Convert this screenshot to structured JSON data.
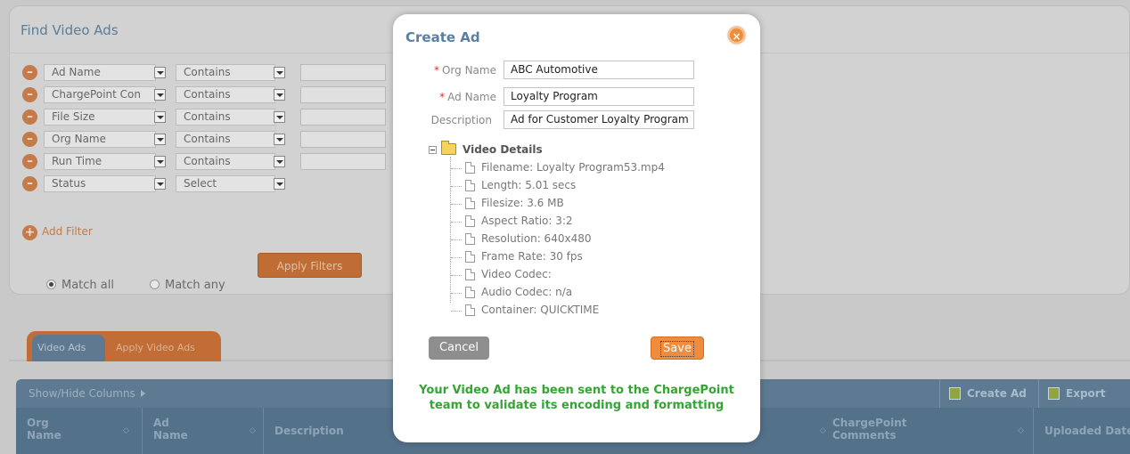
{
  "find_panel": {
    "title": "Find Video Ads",
    "filters": [
      {
        "field": "Ad Name",
        "operator": "Contains",
        "value": ""
      },
      {
        "field": "ChargePoint Con",
        "operator": "Contains",
        "value": ""
      },
      {
        "field": "File Size",
        "operator": "Contains",
        "value": ""
      },
      {
        "field": "Org Name",
        "operator": "Contains",
        "value": ""
      },
      {
        "field": "Run Time",
        "operator": "Contains",
        "value": ""
      },
      {
        "field": "Status",
        "operator": "Select"
      }
    ],
    "add_filter_label": "Add Filter",
    "match_all_label": "Match all",
    "match_any_label": "Match any",
    "match_selected": "Match all",
    "apply_button": "Apply Filters"
  },
  "tabs": [
    {
      "label": "Video Ads",
      "active": true
    },
    {
      "label": "Apply Video Ads",
      "active": false
    }
  ],
  "grid": {
    "show_hide_label": "Show/Hide Columns",
    "create_ad_button": "Create Ad",
    "export_button": "Export",
    "columns": {
      "org_name": "Org Name",
      "ad_name": "Ad Name",
      "description": "Description",
      "chargepoint_comments": "ChargePoint Comments",
      "uploaded_date": "Uploaded Date ("
    }
  },
  "modal": {
    "title": "Create Ad",
    "close_symbol": "×",
    "fields": {
      "org_name_label": "Org Name",
      "org_name_value": "ABC Automotive",
      "ad_name_label": "Ad Name",
      "ad_name_value": "Loyalty Program",
      "description_label": "Description",
      "description_value": "Ad for Customer Loyalty Program",
      "required_marker": "*"
    },
    "tree": {
      "root_label": "Video Details",
      "items": [
        "Filename: Loyalty Program53.mp4",
        "Length: 5.01 secs",
        "Filesize: 3.6 MB",
        "Aspect Ratio: 3:2",
        "Resolution: 640x480",
        "Frame Rate: 30 fps",
        "Video Codec:",
        "Audio Codec: n/a",
        "Container: QUICKTIME"
      ]
    },
    "cancel_button": "Cancel",
    "save_button": "Save",
    "notice_line1": "Your Video Ad has been sent to the ChargePoint",
    "notice_line2": "team to validate its encoding and formatting"
  },
  "colors": {
    "accent_orange": "#f08c3c",
    "title_blue": "#5a7fa3",
    "notice_green": "#34a534",
    "grid_header": "#54718a"
  }
}
